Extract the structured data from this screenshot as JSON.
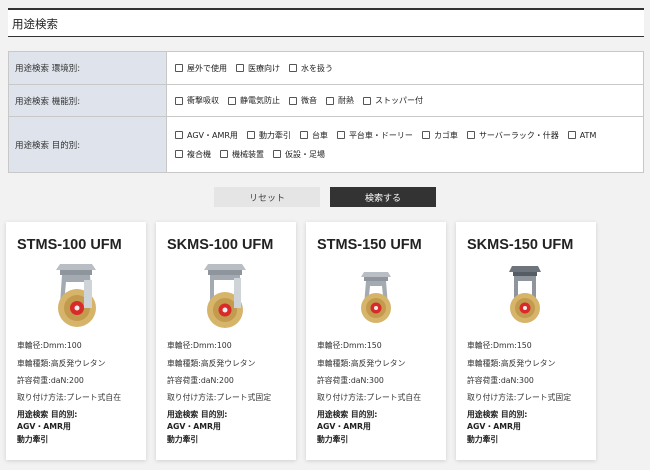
{
  "header": {
    "title": "用途検索"
  },
  "filters": [
    {
      "label": "用途検索 環境別:",
      "options": [
        "屋外で使用",
        "医療向け",
        "水を扱う"
      ]
    },
    {
      "label": "用途検索 機能別:",
      "options": [
        "衝撃吸収",
        "静電気防止",
        "微音",
        "耐熱",
        "ストッパー付"
      ]
    },
    {
      "label": "用途検索 目的別:",
      "options": [
        "AGV・AMR用",
        "動力牽引",
        "台車",
        "平台車・ドーリー",
        "カゴ車",
        "サーバーラック・什器",
        "ATM",
        "複合機",
        "機械装置",
        "仮設・足場"
      ]
    }
  ],
  "buttons": {
    "reset": "リセット",
    "search": "検索する"
  },
  "products": [
    {
      "name": "STMS-100 UFM",
      "wheel_dia": "車輪径:Dmm:100",
      "wheel_type": "車輪種類:高反発ウレタン",
      "load": "許容荷重:daN:200",
      "mount": "取り付け方法:プレート式自在",
      "purpose_label": "用途検索 目的別:",
      "purposes": [
        "AGV・AMR用",
        "動力牽引"
      ]
    },
    {
      "name": "SKMS-100 UFM",
      "wheel_dia": "車輪径:Dmm:100",
      "wheel_type": "車輪種類:高反発ウレタン",
      "load": "許容荷重:daN:200",
      "mount": "取り付け方法:プレート式固定",
      "purpose_label": "用途検索 目的別:",
      "purposes": [
        "AGV・AMR用",
        "動力牽引"
      ]
    },
    {
      "name": "STMS-150 UFM",
      "wheel_dia": "車輪径:Dmm:150",
      "wheel_type": "車輪種類:高反発ウレタン",
      "load": "許容荷重:daN:300",
      "mount": "取り付け方法:プレート式自在",
      "purpose_label": "用途検索 目的別:",
      "purposes": [
        "AGV・AMR用",
        "動力牽引"
      ]
    },
    {
      "name": "SKMS-150 UFM",
      "wheel_dia": "車輪径:Dmm:150",
      "wheel_type": "車輪種類:高反発ウレタン",
      "load": "許容荷重:daN:300",
      "mount": "取り付け方法:プレート式固定",
      "purpose_label": "用途検索 目的別:",
      "purposes": [
        "AGV・AMR用",
        "動力牽引"
      ]
    }
  ],
  "colors": {
    "label_bg": "#dfe4ec",
    "wheel": "#d6b46a",
    "hub": "#d92a2a",
    "search_btn": "#333333"
  }
}
